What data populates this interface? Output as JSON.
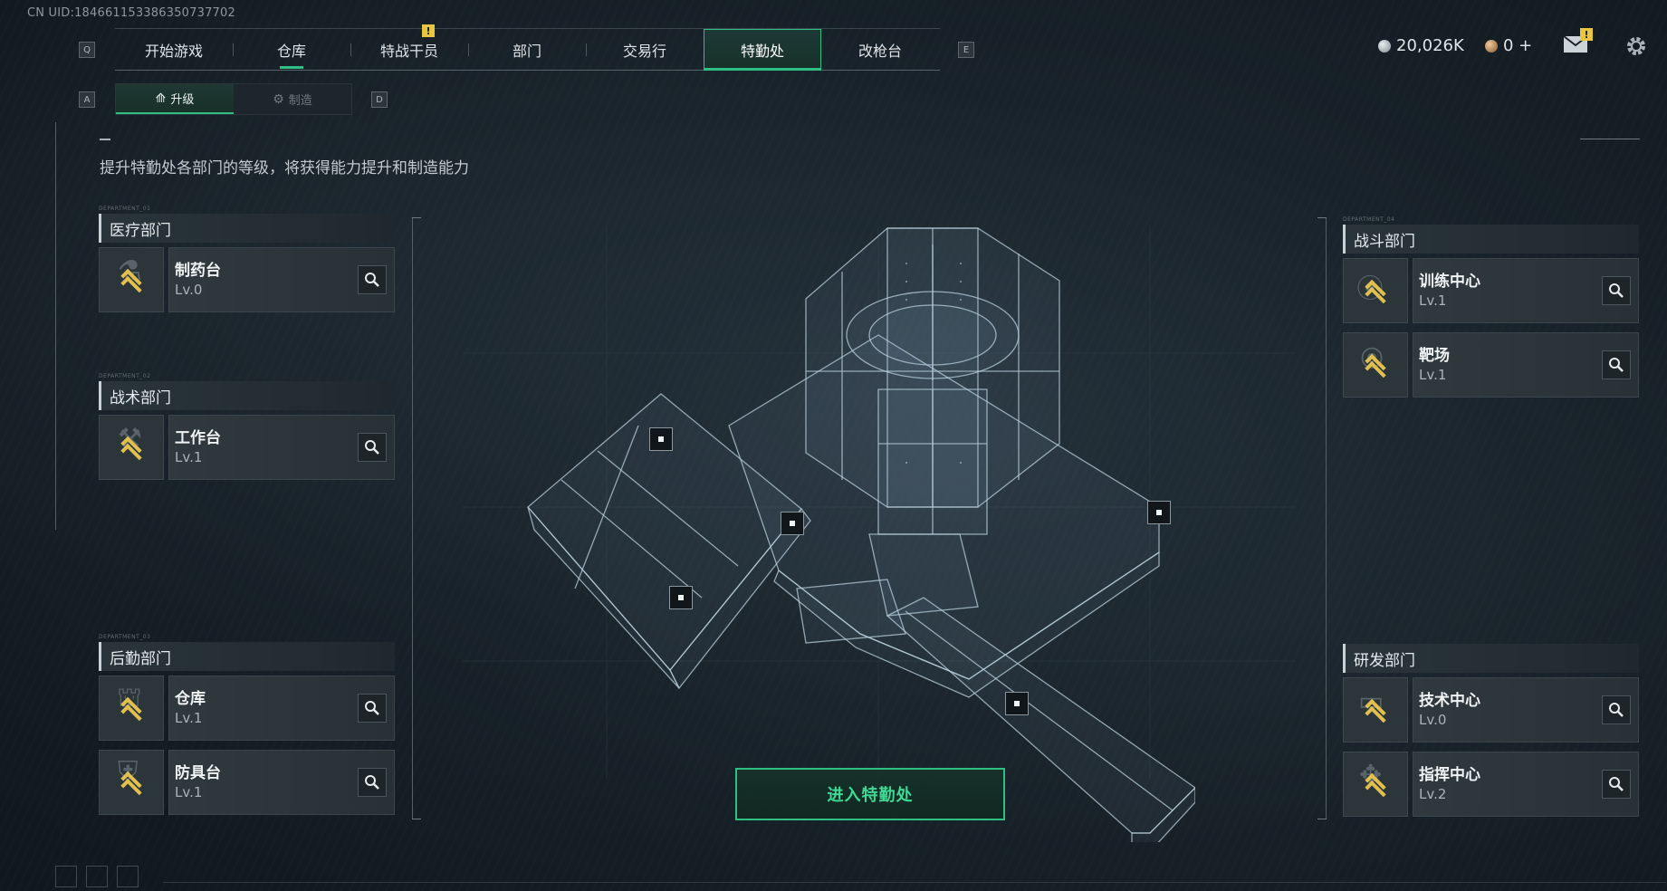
{
  "uid": "CN UID:18466115338635073770​2",
  "nav": {
    "left_key": "Q",
    "right_key": "E",
    "tabs": [
      {
        "label": "开始游戏"
      },
      {
        "label": "仓库"
      },
      {
        "label": "特战干员",
        "badge": "!"
      },
      {
        "label": "部门"
      },
      {
        "label": "交易行"
      },
      {
        "label": "特勤处",
        "active": true
      },
      {
        "label": "改枪台"
      }
    ]
  },
  "currency": {
    "primary": "20,026K",
    "secondary": "0 +",
    "mail_badge": "!"
  },
  "subtabs": {
    "left_key": "A",
    "right_key": "D",
    "items": [
      {
        "label": "升级",
        "active": true
      },
      {
        "label": "制造"
      }
    ]
  },
  "description": "提升特勤处各部门的等级，将获得能力提升和制造能力",
  "departments": {
    "medical": {
      "tag": "DEPARTMENT_01",
      "title": "医疗部门",
      "facilities": [
        {
          "name": "制药台",
          "level": "Lv.0"
        }
      ]
    },
    "tactical": {
      "tag": "DEPARTMENT_02",
      "title": "战术部门",
      "facilities": [
        {
          "name": "工作台",
          "level": "Lv.1"
        }
      ]
    },
    "logistics": {
      "tag": "DEPARTMENT_03",
      "title": "后勤部门",
      "facilities": [
        {
          "name": "仓库",
          "level": "Lv.1"
        },
        {
          "name": "防具台",
          "level": "Lv.1"
        }
      ]
    },
    "combat": {
      "tag": "DEPARTMENT_04",
      "title": "战斗部门",
      "facilities": [
        {
          "name": "训练中心",
          "level": "Lv.1"
        },
        {
          "name": "靶场",
          "level": "Lv.1"
        }
      ]
    },
    "research": {
      "title": "研发部门",
      "facilities": [
        {
          "name": "技术中心",
          "level": "Lv.0"
        },
        {
          "name": "指挥中心",
          "level": "Lv.2"
        }
      ]
    }
  },
  "enter_button": "进入特勤处",
  "colors": {
    "accent_green": "#2fbf84",
    "badge_yellow": "#e7c640",
    "chevron_gold": "#e2c04f",
    "background": "#18222a"
  }
}
